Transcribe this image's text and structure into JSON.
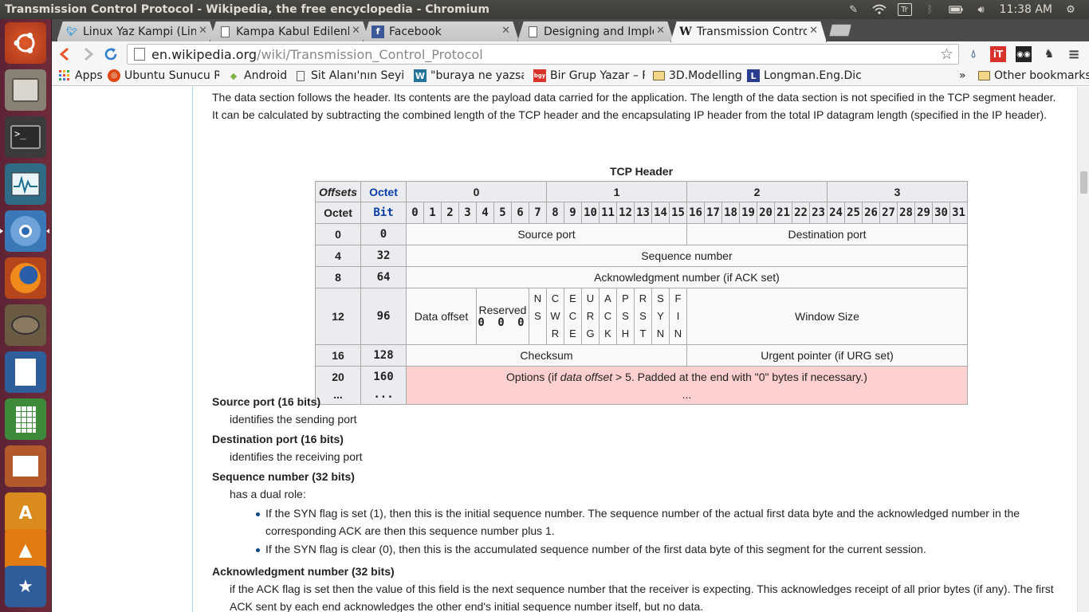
{
  "window_title": "Transmission Control Protocol - Wikipedia, the free encyclopedia - Chromium",
  "panel": {
    "keyboard_layout": "Tr",
    "clock": "11:38 AM"
  },
  "tabs": [
    {
      "label": "Linux Yaz Kampi (Linu",
      "favicon": "twitter-icon"
    },
    {
      "label": "Kampa Kabul Edilenle",
      "favicon": "page-icon"
    },
    {
      "label": "Facebook",
      "favicon": "facebook-icon"
    },
    {
      "label": "Designing and Implem",
      "favicon": "page-icon"
    },
    {
      "label": "Transmission Control P",
      "favicon": "wikipedia-icon",
      "active": true
    }
  ],
  "address_bar": {
    "host": "en.wikipedia.org",
    "path": "/wiki/Transmission_Control_Protocol"
  },
  "bookmarks": [
    {
      "label": "Apps",
      "icon": "apps-grid-icon"
    },
    {
      "label": "Ubuntu Sunucu Re",
      "icon": "ubuntu-icon"
    },
    {
      "label": "Android",
      "icon": "android-icon"
    },
    {
      "label": "Sit Alanı'nın Seyir D",
      "icon": "page-icon"
    },
    {
      "label": "\"buraya ne yazsam",
      "icon": "wordpress-icon"
    },
    {
      "label": "Bir Grup Yazar – Re",
      "icon": "blogger-icon"
    },
    {
      "label": "3D.Modelling",
      "icon": "folder-icon"
    },
    {
      "label": "Longman.Eng.Dic",
      "icon": "dictionary-icon"
    }
  ],
  "bookmarks_overflow": "»",
  "other_bookmarks": "Other bookmarks",
  "article": {
    "intro": "The data section follows the header. Its contents are the payload data carried for the application. The length of the data section is not specified in the TCP segment header. It can be calculated by subtracting the combined length of the TCP header and the encapsulating IP header from the total IP datagram length (specified in the IP header)."
  },
  "table": {
    "caption": "TCP Header",
    "offsets_label": "Offsets",
    "octet_label": "Octet",
    "octet_col_label": "Octet",
    "bit_label": "Bit",
    "octet_numbers": [
      "0",
      "1",
      "2",
      "3"
    ],
    "bits": [
      "0",
      "1",
      "2",
      "3",
      "4",
      "5",
      "6",
      "7",
      "8",
      "9",
      "10",
      "11",
      "12",
      "13",
      "14",
      "15",
      "16",
      "17",
      "18",
      "19",
      "20",
      "21",
      "22",
      "23",
      "24",
      "25",
      "26",
      "27",
      "28",
      "29",
      "30",
      "31"
    ],
    "rows": {
      "r0": {
        "octet": "0",
        "bit": "0",
        "source_port": "Source port",
        "destination_port": "Destination port"
      },
      "r4": {
        "octet": "4",
        "bit": "32",
        "field": "Sequence number"
      },
      "r8": {
        "octet": "8",
        "bit": "64",
        "field": "Acknowledgment number (if ACK set)"
      },
      "r12": {
        "octet": "12",
        "bit": "96",
        "data_offset": "Data offset",
        "reserved": "Reserved",
        "reserved_bits": "0 0 0",
        "window_size": "Window Size",
        "flags": [
          [
            "N",
            "S",
            ""
          ],
          [
            "C",
            "W",
            "R"
          ],
          [
            "E",
            "C",
            "E"
          ],
          [
            "U",
            "R",
            "G"
          ],
          [
            "A",
            "C",
            "K"
          ],
          [
            "P",
            "S",
            "H"
          ],
          [
            "R",
            "S",
            "T"
          ],
          [
            "S",
            "Y",
            "N"
          ],
          [
            "F",
            "I",
            "N"
          ]
        ]
      },
      "r16": {
        "octet": "16",
        "bit": "128",
        "checksum": "Checksum",
        "urgent_pointer": "Urgent pointer (if URG set)"
      },
      "r20": {
        "octet": "20",
        "octet_more": "...",
        "bit": "160",
        "bit_more": "...",
        "options_pre": "Options (if ",
        "options_em": "data offset",
        "options_post": " > 5. Padded at the end with \"0\" bytes if necessary.)",
        "options_more": "..."
      }
    }
  },
  "fields": [
    {
      "term": "Source port (16 bits)",
      "desc": "identifies the sending port"
    },
    {
      "term": "Destination port (16 bits)",
      "desc": "identifies the receiving port"
    },
    {
      "term": "Sequence number (32 bits)",
      "desc": "has a dual role:",
      "bullets": [
        "If the SYN flag is set (1), then this is the initial sequence number. The sequence number of the actual first data byte and the acknowledged number in the corresponding ACK are then this sequence number plus 1.",
        "If the SYN flag is clear (0), then this is the accumulated sequence number of the first data byte of this segment for the current session."
      ]
    },
    {
      "term": "Acknowledgment number (32 bits)",
      "desc": "if the ACK flag is set then the value of this field is the next sequence number that the receiver is expecting. This acknowledges receipt of all prior bytes (if any). The first ACK sent by each end acknowledges the other end's initial sequence number itself, but no data."
    }
  ]
}
